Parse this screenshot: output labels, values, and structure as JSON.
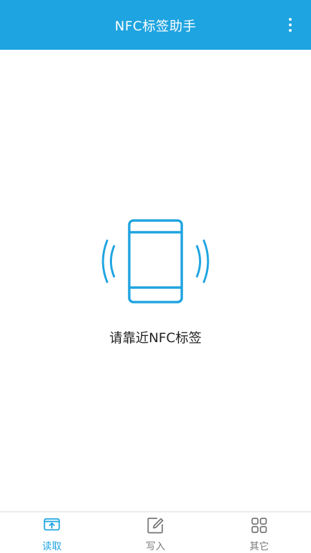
{
  "app_bar": {
    "title": "NFC标签助手",
    "menu_icon": "more-vertical-icon"
  },
  "main": {
    "illustration_icon": "phone-nfc-waves-icon",
    "prompt": "请靠近NFC标签"
  },
  "bottom_nav": {
    "items": [
      {
        "label": "读取",
        "icon": "read-icon",
        "active": true
      },
      {
        "label": "写入",
        "icon": "edit-icon",
        "active": false
      },
      {
        "label": "其它",
        "icon": "grid-icon",
        "active": false
      }
    ]
  },
  "colors": {
    "primary": "#1ea4e0",
    "inactive": "#7a7a7a"
  }
}
